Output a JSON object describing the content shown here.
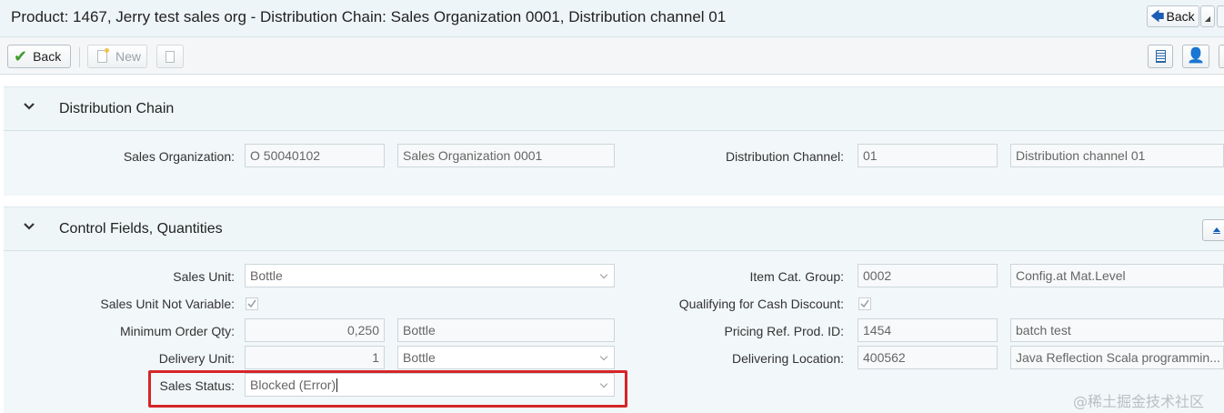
{
  "header": {
    "title": "Product: 1467, Jerry test sales org - Distribution Chain: Sales Organization 0001, Distribution channel 01",
    "back_label": "Back"
  },
  "toolbar": {
    "back_label": "Back",
    "new_label": "New"
  },
  "distribution_chain": {
    "title": "Distribution Chain",
    "sales_org": {
      "label": "Sales Organization:",
      "value": "O 50040102",
      "description": "Sales Organization 0001"
    },
    "dist_channel": {
      "label": "Distribution Channel:",
      "value": "01",
      "description": "Distribution channel 01"
    }
  },
  "control_fields": {
    "title": "Control Fields, Quantities",
    "sales_unit": {
      "label": "Sales Unit:",
      "value": "Bottle"
    },
    "sales_unit_not_variable": {
      "label": "Sales Unit Not Variable:",
      "checked": true
    },
    "min_order_qty": {
      "label": "Minimum Order Qty:",
      "value": "0,250",
      "unit": "Bottle"
    },
    "delivery_unit": {
      "label": "Delivery Unit:",
      "value": "1",
      "unit": "Bottle"
    },
    "sales_status": {
      "label": "Sales Status:",
      "value": "Blocked (Error)"
    },
    "item_cat_group": {
      "label": "Item Cat. Group:",
      "value": "0002",
      "description": "Config.at Mat.Level"
    },
    "cash_discount": {
      "label": "Qualifying for Cash Discount:",
      "checked": true
    },
    "pricing_ref": {
      "label": "Pricing Ref. Prod. ID:",
      "value": "1454",
      "description": "batch test"
    },
    "delivering_location": {
      "label": "Delivering Location:",
      "value": "400562",
      "description": "Java Reflection Scala programmin..."
    }
  },
  "watermark": "@稀土掘金技术社区",
  "colors": {
    "highlight": "#d62528",
    "accent": "#1b5db5",
    "check": "#3e9b2e"
  }
}
